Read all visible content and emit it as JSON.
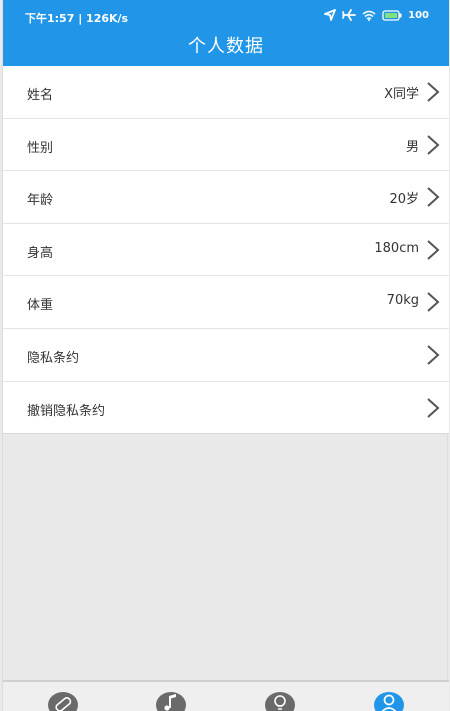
{
  "status_bar": {
    "time_speed": "下午1:57 | 126K/s",
    "battery": "100",
    "icons": [
      "location-arrow-icon",
      "airplane-icon",
      "wifi-icon",
      "battery-icon"
    ]
  },
  "header": {
    "title": "个人数据"
  },
  "rows": [
    {
      "label": "姓名",
      "value": "X同学"
    },
    {
      "label": "性别",
      "value": "男"
    },
    {
      "label": "年龄",
      "value": "20岁"
    },
    {
      "label": "身高",
      "value": "180cm"
    },
    {
      "label": "体重",
      "value": "70kg"
    },
    {
      "label": "隐私条约",
      "value": ""
    },
    {
      "label": "撤销隐私条约",
      "value": ""
    }
  ],
  "tabs": [
    {
      "icon": "bandage-icon"
    },
    {
      "icon": "music-note-icon"
    },
    {
      "icon": "lightbulb-icon"
    },
    {
      "icon": "user-icon",
      "active": true
    }
  ],
  "colors": {
    "primary": "#2196e8",
    "tab_inactive": "#6a6a6a"
  }
}
